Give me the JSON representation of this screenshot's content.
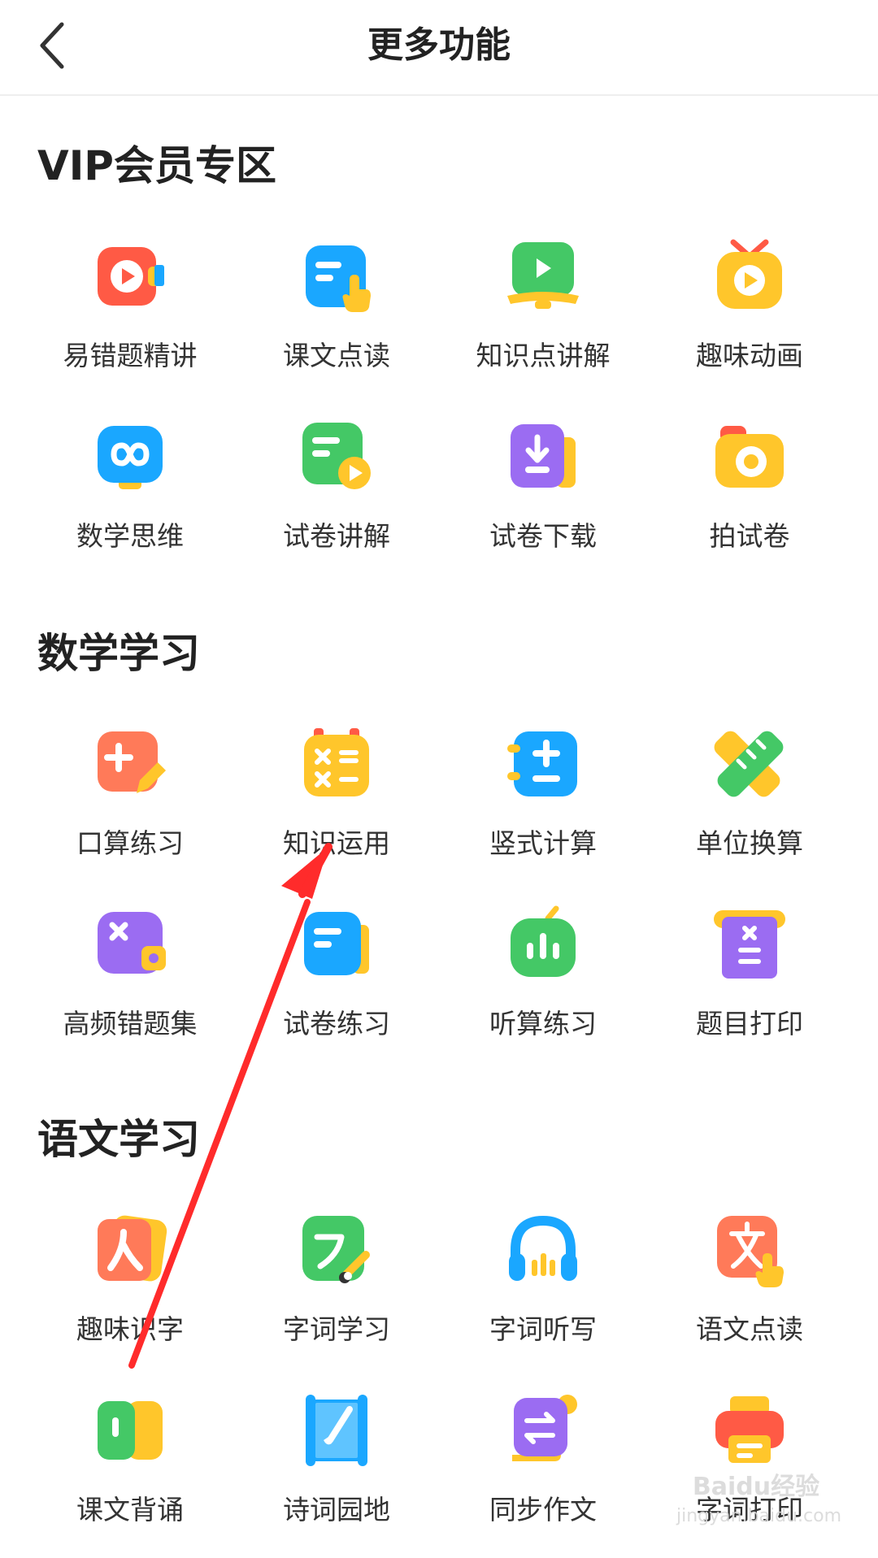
{
  "header": {
    "title": "更多功能"
  },
  "colors": {
    "accent_red": "#ff5a45",
    "annotation_red": "#ff2b2b",
    "orange": "#ff7a59",
    "blue": "#1aa7ff",
    "green": "#44c866",
    "yellow": "#ffc62b",
    "purple": "#9b6cf2"
  },
  "sections": [
    {
      "title": "VIP会员专区",
      "items": [
        {
          "label": "易错题精讲",
          "icon": "video-play-icon"
        },
        {
          "label": "课文点读",
          "icon": "text-tap-icon"
        },
        {
          "label": "知识点讲解",
          "icon": "screen-play-icon"
        },
        {
          "label": "趣味动画",
          "icon": "tv-play-icon"
        },
        {
          "label": "数学思维",
          "icon": "infinity-icon"
        },
        {
          "label": "试卷讲解",
          "icon": "paper-play-icon"
        },
        {
          "label": "试卷下载",
          "icon": "download-icon"
        },
        {
          "label": "拍试卷",
          "icon": "camera-icon"
        }
      ]
    },
    {
      "title": "数学学习",
      "items": [
        {
          "label": "口算练习",
          "icon": "plus-pencil-icon"
        },
        {
          "label": "知识运用",
          "icon": "calculator-icon"
        },
        {
          "label": "竖式计算",
          "icon": "plus-minus-icon"
        },
        {
          "label": "单位换算",
          "icon": "ruler-icon"
        },
        {
          "label": "高频错题集",
          "icon": "wrong-book-icon"
        },
        {
          "label": "试卷练习",
          "icon": "paper-icon"
        },
        {
          "label": "听算练习",
          "icon": "audio-bars-icon"
        },
        {
          "label": "题目打印",
          "icon": "print-sheet-icon"
        }
      ]
    },
    {
      "title": "语文学习",
      "items": [
        {
          "label": "趣味识字",
          "icon": "character-card-icon"
        },
        {
          "label": "字词学习",
          "icon": "brush-stroke-icon"
        },
        {
          "label": "字词听写",
          "icon": "headphones-icon"
        },
        {
          "label": "语文点读",
          "icon": "wen-tap-icon"
        },
        {
          "label": "课文背诵",
          "icon": "book-open-icon"
        },
        {
          "label": "诗词园地",
          "icon": "scroll-brush-icon"
        },
        {
          "label": "同步作文",
          "icon": "swap-paper-icon"
        },
        {
          "label": "字词打印",
          "icon": "printer-icon"
        }
      ]
    }
  ],
  "watermark": {
    "line1": "Baidu经验",
    "line2": "jingyan.baidu.com"
  }
}
